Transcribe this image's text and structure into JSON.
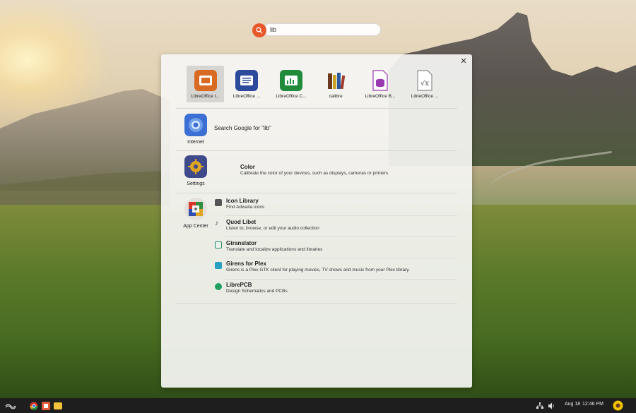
{
  "search": {
    "value": "lib",
    "placeholder": ""
  },
  "apps": [
    {
      "label": "LibreOffice I...",
      "color": "#d86a22"
    },
    {
      "label": "LibreOffice ...",
      "color": "#2c4a9c"
    },
    {
      "label": "LibreOffice C...",
      "color": "#1f8b3b"
    },
    {
      "label": "calibre",
      "color": "#7a4a2a"
    },
    {
      "label": "LibreOffice B...",
      "color": "#9a3ab0"
    },
    {
      "label": "LibreOffice ...",
      "color": "#8c8c8c"
    }
  ],
  "internet": {
    "label": "Internet",
    "google_text": "Search Google for \"lib\""
  },
  "settings": {
    "label": "Settings",
    "result": {
      "title": "Color",
      "desc": "Calibrate the color of your devices, such as displays, cameras or printers"
    }
  },
  "appcenter": {
    "label": "App Center",
    "results": [
      {
        "title": "Icon Library",
        "desc": "Find Adwaita icons",
        "icon": "icon-library-icon",
        "color": "#555555"
      },
      {
        "title": "Quod Libet",
        "desc": "Listen to, browse, or edit your audio collection",
        "icon": "quod-libet-icon",
        "color": "#444444"
      },
      {
        "title": "Gtranslator",
        "desc": "Translate and localize applications and libraries",
        "icon": "gtranslator-icon",
        "color": "#2a8a6a"
      },
      {
        "title": "Girens for Plex",
        "desc": "Girens is a Plex GTK client for playing movies, TV shows and music from your Plex library.",
        "icon": "girens-icon",
        "color": "#2aa0c0"
      },
      {
        "title": "LibrePCB",
        "desc": "Design Schematics and PCBs",
        "icon": "librepcb-icon",
        "color": "#1fa060"
      }
    ]
  },
  "taskbar": {
    "date": "Aug 18",
    "time": "12:46 PM"
  }
}
